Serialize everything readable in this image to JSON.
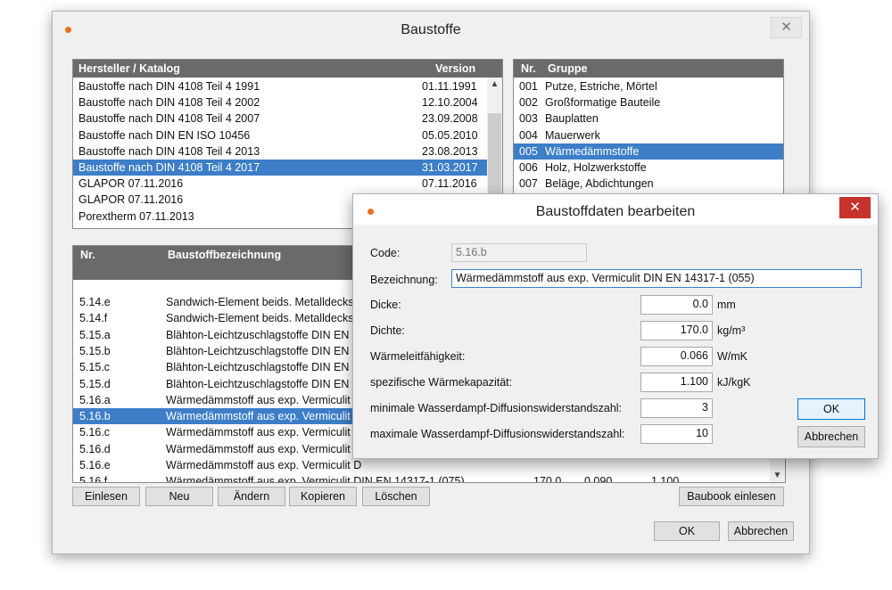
{
  "main": {
    "title": "Baustoffe",
    "close_glyph": "✕",
    "catalog": {
      "col_name": "Hersteller / Katalog",
      "col_version": "Version",
      "rows": [
        {
          "name": "Baustoffe nach DIN 4108 Teil 4 1991",
          "version": "01.11.1991"
        },
        {
          "name": "Baustoffe nach DIN 4108 Teil 4 2002",
          "version": "12.10.2004"
        },
        {
          "name": "Baustoffe nach DIN 4108 Teil 4 2007",
          "version": "23.09.2008"
        },
        {
          "name": "Baustoffe nach DIN EN ISO 10456",
          "version": "05.05.2010"
        },
        {
          "name": "Baustoffe nach DIN 4108 Teil 4 2013",
          "version": "23.08.2013"
        },
        {
          "name": "Baustoffe nach DIN 4108 Teil 4 2017",
          "version": "31.03.2017",
          "selected": true
        },
        {
          "name": "GLAPOR 07.11.2016",
          "version": "07.11.2016"
        },
        {
          "name": "GLAPOR 07.11.2016",
          "version": ""
        },
        {
          "name": "Porextherm 07.11.2013",
          "version": ""
        }
      ]
    },
    "groups": {
      "col_nr": "Nr.",
      "col_group": "Gruppe",
      "rows": [
        {
          "nr": "001",
          "name": "Putze, Estriche, Mörtel"
        },
        {
          "nr": "002",
          "name": "Großformatige Bauteile"
        },
        {
          "nr": "003",
          "name": "Bauplatten"
        },
        {
          "nr": "004",
          "name": "Mauerwerk"
        },
        {
          "nr": "005",
          "name": "Wärmedämmstoffe",
          "selected": true
        },
        {
          "nr": "006",
          "name": "Holz, Holzwerkstoffe"
        },
        {
          "nr": "007",
          "name": "Beläge, Abdichtungen"
        }
      ]
    },
    "materials": {
      "col_nr": "Nr.",
      "col_name": "Baustoffbezeichnung",
      "rows": [
        {
          "nr": "5.14.e",
          "name": "Sandwich-Element beids. Metalldecksc"
        },
        {
          "nr": "5.14.f",
          "name": "Sandwich-Element beids. Metalldecksc"
        },
        {
          "nr": "5.15.a",
          "name": "Blähton-Leichtzuschlagstoffe DIN EN 1"
        },
        {
          "nr": "5.15.b",
          "name": "Blähton-Leichtzuschlagstoffe DIN EN 1"
        },
        {
          "nr": "5.15.c",
          "name": "Blähton-Leichtzuschlagstoffe DIN EN 1"
        },
        {
          "nr": "5.15.d",
          "name": "Blähton-Leichtzuschlagstoffe DIN EN 1"
        },
        {
          "nr": "5.16.a",
          "name": "Wärmedämmstoff aus exp. Vermiculit D"
        },
        {
          "nr": "5.16.b",
          "name": "Wärmedämmstoff aus exp. Vermiculit D",
          "selected": true
        },
        {
          "nr": "5.16.c",
          "name": "Wärmedämmstoff aus exp. Vermiculit D"
        },
        {
          "nr": "5.16.d",
          "name": "Wärmedämmstoff aus exp. Vermiculit D"
        },
        {
          "nr": "5.16.e",
          "name": "Wärmedämmstoff aus exp. Vermiculit D"
        },
        {
          "nr": "5.16.f",
          "name": "Wärmedämmstoff aus exp. Vermiculit DIN EN 14317-1 (075)",
          "v1": "170.0",
          "v2": "0.090",
          "v3": "1.100"
        }
      ]
    },
    "buttons": {
      "einlesen": "Einlesen",
      "neu": "Neu",
      "aendern": "Ändern",
      "kopieren": "Kopieren",
      "loeschen": "Löschen",
      "baubook": "Baubook einlesen",
      "ok": "OK",
      "abbrechen": "Abbrechen"
    }
  },
  "dialog": {
    "title": "Baustoffdaten bearbeiten",
    "close_glyph": "✕",
    "code_label": "Code:",
    "code_value": "5.16.b",
    "bez_label": "Bezeichnung:",
    "bez_value": "Wärmedämmstoff aus exp. Vermiculit DIN EN 14317-1 (055)",
    "fields": [
      {
        "label": "Dicke:",
        "value": "0.0",
        "unit": "mm"
      },
      {
        "label": "Dichte:",
        "value": "170.0",
        "unit": "kg/m³"
      },
      {
        "label": "Wärmeleitfähigkeit:",
        "value": "0.066",
        "unit": "W/mK"
      },
      {
        "label": "spezifische Wärmekapazität:",
        "value": "1.100",
        "unit": "kJ/kgK"
      },
      {
        "label": "minimale Wasserdampf-Diffusionswiderstandszahl:",
        "value": "3",
        "unit": ""
      },
      {
        "label": "maximale Wasserdampf-Diffusionswiderstandszahl:",
        "value": "10",
        "unit": ""
      }
    ],
    "ok": "OK",
    "abbrechen": "Abbrechen"
  }
}
